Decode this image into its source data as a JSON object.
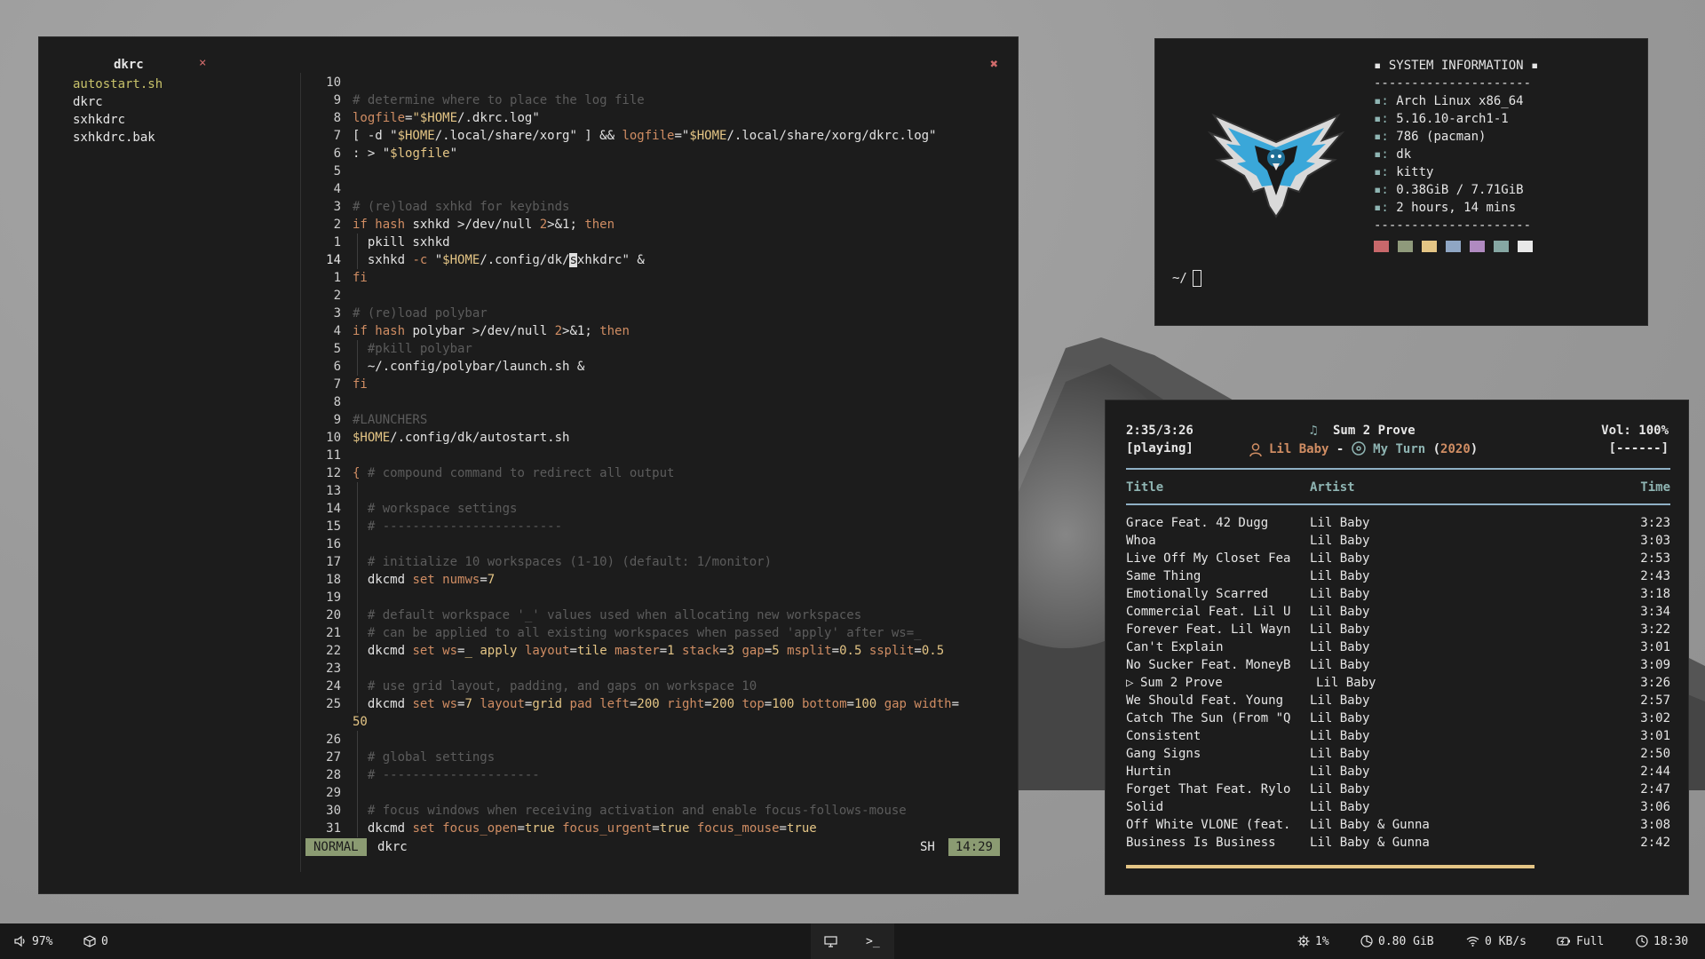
{
  "editor": {
    "tree": {
      "title": "dkrc",
      "close_glyph": "×",
      "files": [
        "autostart.sh",
        "dkrc",
        "sxhkdrc",
        "sxhkdrc.bak"
      ]
    },
    "close_glyph": "✖",
    "status": {
      "mode": "NORMAL",
      "file": "dkrc",
      "filetype": "SH",
      "position": "14:29"
    }
  },
  "sysinfo": {
    "title": "▪ SYSTEM INFORMATION ▪",
    "separator": "---------------------",
    "bullet": "▪:",
    "rows": [
      "Arch Linux x86_64",
      "5.16.10-arch1-1",
      "786 (pacman)",
      "dk",
      "kitty",
      "0.38GiB / 7.71GiB",
      "2 hours, 14 mins"
    ],
    "palette": [
      "#c8686b",
      "#8f9a7b",
      "#e4c585",
      "#8fa6c4",
      "#b08ac0",
      "#86a7a3",
      "#e8e8e8"
    ],
    "prompt": "~/"
  },
  "music": {
    "elapsed": "2:35/3:26",
    "state": "[playing]",
    "song": "Sum 2 Prove",
    "artist": "Lil Baby",
    "album": "My Turn",
    "year": "2020",
    "volume": "Vol: 100%",
    "repeat": "[------]",
    "progress": 0.75,
    "headers": {
      "title": "Title",
      "artist": "Artist",
      "time": "Time"
    },
    "tracks": [
      {
        "title": "Grace Feat. 42 Dugg",
        "artist": "Lil Baby",
        "time": "3:23"
      },
      {
        "title": "Whoa",
        "artist": "Lil Baby",
        "time": "3:03"
      },
      {
        "title": "Live Off My Closet Fea",
        "artist": "Lil Baby",
        "time": "2:53"
      },
      {
        "title": "Same Thing",
        "artist": "Lil Baby",
        "time": "2:43"
      },
      {
        "title": "Emotionally Scarred",
        "artist": "Lil Baby",
        "time": "3:18"
      },
      {
        "title": "Commercial Feat. Lil U",
        "artist": "Lil Baby",
        "time": "3:34"
      },
      {
        "title": "Forever Feat. Lil Wayn",
        "artist": "Lil Baby",
        "time": "3:22"
      },
      {
        "title": "Can't Explain",
        "artist": "Lil Baby",
        "time": "3:01"
      },
      {
        "title": "No Sucker Feat. MoneyB",
        "artist": "Lil Baby",
        "time": "3:09"
      },
      {
        "title": "Sum 2 Prove",
        "artist": "Lil Baby",
        "time": "3:26",
        "playing": true
      },
      {
        "title": "We Should Feat. Young",
        "artist": "Lil Baby",
        "time": "2:57"
      },
      {
        "title": "Catch The Sun (From \"Q",
        "artist": "Lil Baby",
        "time": "3:02"
      },
      {
        "title": "Consistent",
        "artist": "Lil Baby",
        "time": "3:01"
      },
      {
        "title": "Gang Signs",
        "artist": "Lil Baby",
        "time": "2:50"
      },
      {
        "title": "Hurtin",
        "artist": "Lil Baby",
        "time": "2:44"
      },
      {
        "title": "Forget That Feat. Rylo",
        "artist": "Lil Baby",
        "time": "2:47"
      },
      {
        "title": "Solid",
        "artist": "Lil Baby",
        "time": "3:06"
      },
      {
        "title": "Off White VLONE (feat.",
        "artist": "Lil Baby & Gunna",
        "time": "3:08"
      },
      {
        "title": "Business Is Business",
        "artist": "Lil Baby & Gunna",
        "time": "2:42"
      }
    ]
  },
  "taskbar": {
    "volume": "97%",
    "packages": "0",
    "terminal_glyph": ">_",
    "cpu": "1%",
    "memory": "0.80 GiB",
    "network": "0 KB/s",
    "battery": "Full",
    "clock": "18:30"
  }
}
